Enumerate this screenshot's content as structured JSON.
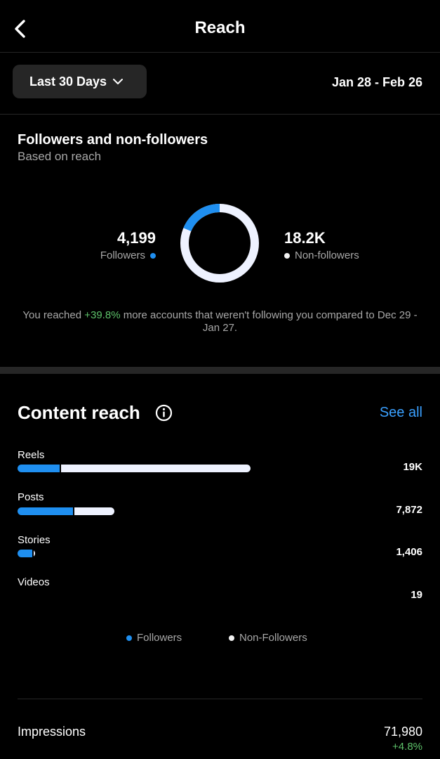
{
  "header": {
    "title": "Reach"
  },
  "range": {
    "selector_label": "Last 30 Days",
    "dates": "Jan 28 - Feb 26"
  },
  "audience": {
    "title": "Followers and non-followers",
    "subtitle": "Based on reach",
    "followers": {
      "value": "4,199",
      "label": "Followers"
    },
    "non_followers": {
      "value": "18.2K",
      "label": "Non-followers"
    },
    "follower_share": 0.187,
    "note_before": "You reached ",
    "note_change": "+39.8%",
    "note_after": " more accounts that weren't following you compared to Dec 29 - Jan 27."
  },
  "content_reach": {
    "title": "Content reach",
    "see_all": "See all",
    "rows": [
      {
        "label": "Reels",
        "value": "19K",
        "followers_share": 0.18,
        "total": 19000
      },
      {
        "label": "Posts",
        "value": "7,872",
        "followers_share": 0.57,
        "total": 7872
      },
      {
        "label": "Stories",
        "value": "1,406",
        "followers_share": 0.85,
        "total": 1406
      },
      {
        "label": "Videos",
        "value": "19",
        "followers_share": 0,
        "total": 19
      }
    ],
    "legend": {
      "followers": "Followers",
      "non_followers": "Non-Followers"
    }
  },
  "impressions": {
    "label": "Impressions",
    "value": "71,980",
    "change": "+4.8%"
  },
  "colors": {
    "followers": "#1f8ff0",
    "non_followers": "#eef2ff",
    "positive": "#5dc26a",
    "link": "#3aa0ff"
  }
}
